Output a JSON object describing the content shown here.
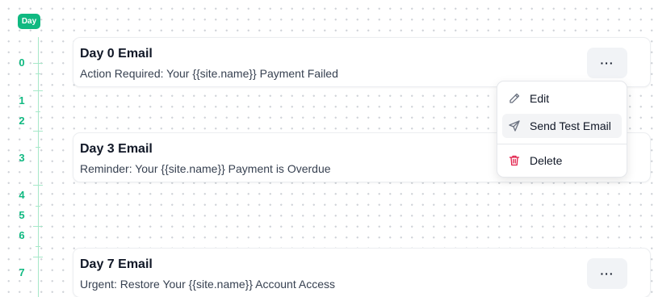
{
  "timeline": {
    "header_label": "Day",
    "accent_color": "#10b981",
    "day_labels": [
      "0",
      "1",
      "2",
      "3",
      "4",
      "5",
      "6",
      "7"
    ]
  },
  "emails": [
    {
      "title": "Day 0 Email",
      "subject": "Action Required: Your {{site.name}} Payment Failed",
      "menu_label": "···"
    },
    {
      "title": "Day 3 Email",
      "subject": "Reminder: Your {{site.name}} Payment is Overdue"
    },
    {
      "title": "Day 7 Email",
      "subject": "Urgent: Restore Your {{site.name}} Account Access",
      "menu_label": "···"
    }
  ],
  "context_menu": {
    "items": [
      {
        "label": "Edit",
        "icon": "pencil-icon"
      },
      {
        "label": "Send Test Email",
        "icon": "send-icon"
      },
      {
        "label": "Delete",
        "icon": "trash-icon",
        "color": "#e11d48"
      }
    ]
  }
}
